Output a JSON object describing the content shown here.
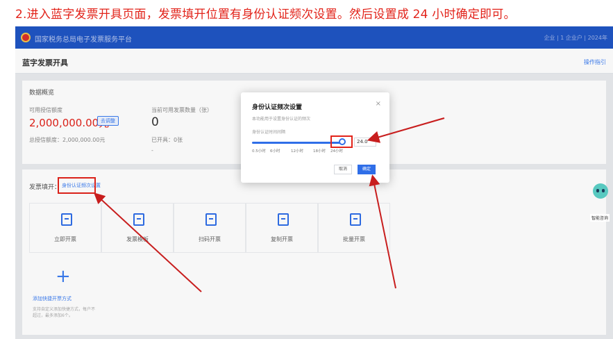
{
  "instruction": "2.进入蓝字发票开具页面，发票填开位置有身份认证频次设置。然后设置成 24 小时确定即可。",
  "colors": {
    "accent": "#2f6ee8",
    "annotation_red": "#e2231a",
    "topbar": "#1f55c4"
  },
  "app": {
    "system_title": "国家税务总局电子发票服务平台",
    "user_info": "企业 | 1 企业户 | 2024年"
  },
  "page": {
    "title": "蓝字发票开具",
    "help_link": "操作指引"
  },
  "overview": {
    "title": "数据概览",
    "credit_label": "可用授信额度",
    "credit_value": "2,000,000.00元",
    "credit_badge": "去调整",
    "total_credit": "总授信额度：2,000,000.00元",
    "count_label": "当前可用发票数量（张）",
    "count_value": "0",
    "issued": "已开具：0张",
    "issued_sub": "-"
  },
  "issue_section": {
    "title": "发票填开：",
    "auth_link": "身份认证频次设置",
    "tiles": [
      {
        "label": "立即开票",
        "icon": "invoice-icon"
      },
      {
        "label": "发票模板",
        "icon": "template-icon"
      },
      {
        "label": "扫码开票",
        "icon": "qrcode-icon"
      },
      {
        "label": "复制开票",
        "icon": "copy-icon"
      },
      {
        "label": "批量开票",
        "icon": "batch-icon"
      }
    ],
    "add": {
      "label": "添加快捷开票方式",
      "desc": "支持自定义添加快捷方式，每户不超过，最多添加6个。"
    }
  },
  "modal": {
    "title": "身份认证频次设置",
    "close": "×",
    "desc": "本功能用于设置身份认证的频次",
    "label": "身份认证时间间隔",
    "value": "24.0",
    "slider_fraction": 1.0,
    "ticks": [
      "0.5小时",
      "6小时",
      "12小时",
      "18小时",
      "24小时"
    ],
    "cancel": "取消",
    "ok": "确定"
  },
  "assistant": {
    "label": "智能咨询"
  }
}
